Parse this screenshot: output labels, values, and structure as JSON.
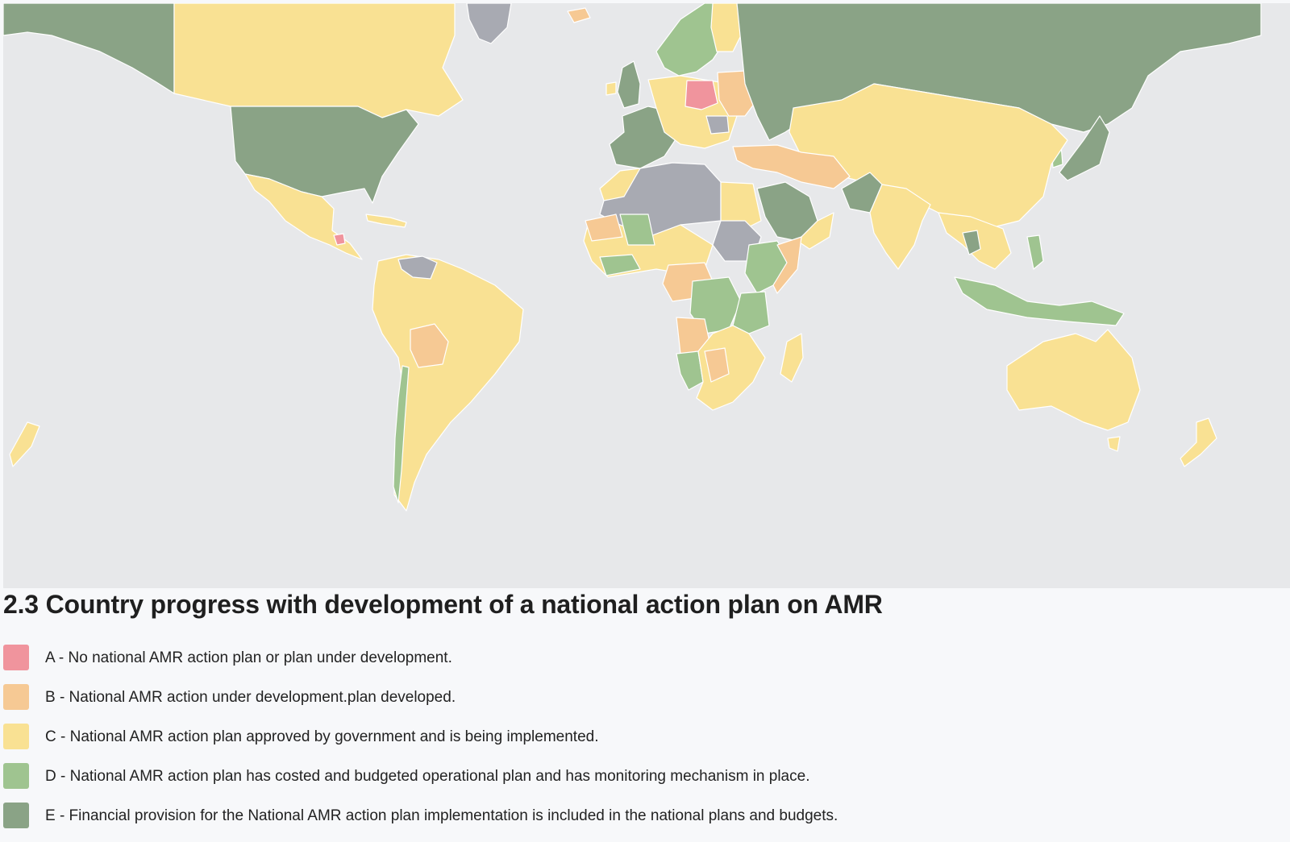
{
  "map": {
    "background_color": "#e7e8ea",
    "border_color": "#ffffff"
  },
  "title": "2.3 Country progress with development of a national action plan on AMR",
  "legend": {
    "items": [
      {
        "key": "A",
        "label": "A - No national AMR action plan or plan under development.",
        "color": "#f0949d"
      },
      {
        "key": "B",
        "label": "B - National AMR action under development.plan developed.",
        "color": "#f6c994"
      },
      {
        "key": "C",
        "label": "C - National AMR action plan approved by government and is being implemented.",
        "color": "#f9e193"
      },
      {
        "key": "D",
        "label": "D - National AMR action plan has costed and budgeted operational plan and has monitoring mechanism in place.",
        "color": "#9fc490"
      },
      {
        "key": "E",
        "label": "E - Financial provision for the National AMR action plan implementation is included in the national plans and budgets.",
        "color": "#8aa386"
      }
    ],
    "no_data_color": "#a8aab2"
  }
}
